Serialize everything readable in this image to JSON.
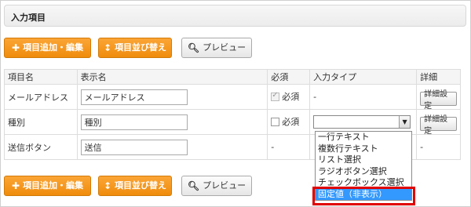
{
  "section": {
    "title": "入力項目"
  },
  "toolbar": {
    "add_edit_label": "項目追加・編集",
    "add_edit_icon": "plus-icon",
    "reorder_label": "項目並び替え",
    "reorder_icon": "up-down-arrow-icon",
    "preview_label": "プレビュー",
    "preview_icon": "search-icon"
  },
  "table": {
    "headers": [
      "項目名",
      "表示名",
      "必須",
      "入力タイプ",
      "詳細"
    ],
    "rows": [
      {
        "name": "メールアドレス",
        "display": "メールアドレス",
        "required_label": "必須",
        "required": true,
        "required_disabled": true,
        "input_type": "-",
        "detail": "詳細設定"
      },
      {
        "name": "種別",
        "display": "種別",
        "required_label": "必須",
        "required": false,
        "required_disabled": false,
        "input_type": "",
        "detail": "詳細設定"
      },
      {
        "name": "送信ボタン",
        "display": "送信",
        "required_label": "",
        "required_dash": "-",
        "input_type": "",
        "detail": "-"
      }
    ]
  },
  "dropdown": {
    "options": [
      "一行テキスト",
      "複数行テキスト",
      "リスト選択",
      "ラジオボタン選択",
      "チェックボックス選択",
      "固定値（非表示）"
    ],
    "highlighted_option": "固定値（非表示）"
  },
  "colors": {
    "button_orange": "#f39a1f",
    "highlight_red": "#e00000",
    "selected_blue": "#3399ff"
  }
}
